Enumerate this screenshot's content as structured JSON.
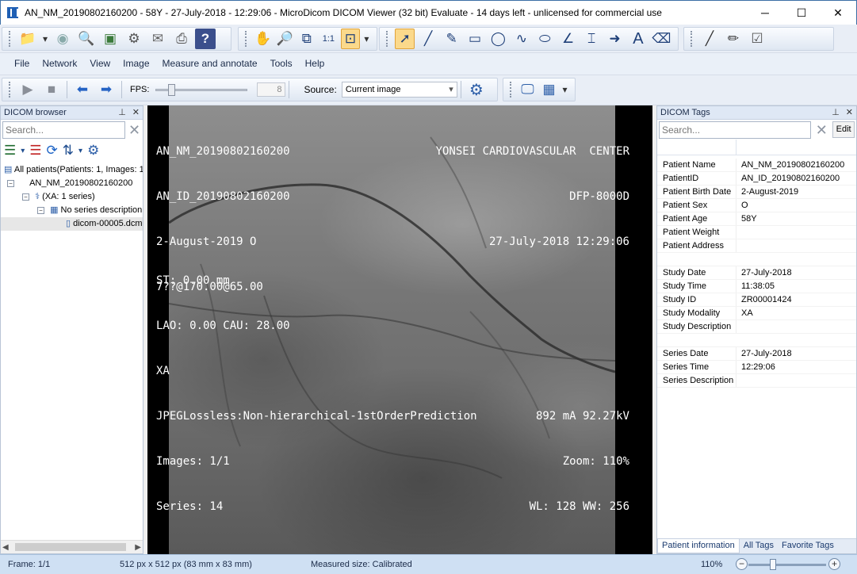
{
  "window": {
    "title": "AN_NM_20190802160200 - 58Y - 27-July-2018 - 12:29:06 - MicroDicom DICOM Viewer (32 bit) Evaluate - 14 days left - unlicensed for commercial use"
  },
  "menu": [
    "File",
    "Network",
    "View",
    "Image",
    "Measure and annotate",
    "Tools",
    "Help"
  ],
  "playback": {
    "fps_label": "FPS:",
    "fps_value": "8",
    "fps_slider_level": 0.15,
    "source_label": "Source:",
    "source_value": "Current image"
  },
  "browser": {
    "title": "DICOM browser",
    "search_placeholder": "Search...",
    "tree": {
      "root": "All patients(Patients: 1, Images: 1)",
      "patient": "AN_NM_20190802160200",
      "study": "(XA: 1 series)",
      "series": "No series description",
      "file": "dicom-00005.dcm"
    }
  },
  "viewer": {
    "top_left": [
      "AN_NM_20190802160200",
      "AN_ID_20190802160200",
      "2-August-2019 O",
      "7??@170.00@65.00"
    ],
    "top_right": [
      "YONSEI CARDIOVASCULAR  CENTER",
      "DFP-8000D",
      "27-July-2018 12:29:06"
    ],
    "bottom_left": [
      "ST: 0.00 mm",
      "LAO: 0.00 CAU: 28.00",
      "XA",
      "JPEGLossless:Non-hierarchical-1stOrderPrediction",
      "Images: 1/1",
      "Series: 14"
    ],
    "bottom_right": [
      "892 mA 92.27kV",
      "Zoom: 110%",
      "WL: 128 WW: 256"
    ]
  },
  "tags": {
    "title": "DICOM Tags",
    "search_placeholder": "Search...",
    "edit_label": "Edit",
    "groups": [
      [
        {
          "k": "Patient Name",
          "v": "AN_NM_20190802160200"
        },
        {
          "k": "PatientID",
          "v": "AN_ID_20190802160200"
        },
        {
          "k": "Patient Birth Date",
          "v": "2-August-2019"
        },
        {
          "k": "Patient Sex",
          "v": "O"
        },
        {
          "k": "Patient Age",
          "v": "58Y"
        },
        {
          "k": "Patient Weight",
          "v": ""
        },
        {
          "k": "Patient Address",
          "v": ""
        }
      ],
      [
        {
          "k": "Study Date",
          "v": "27-July-2018"
        },
        {
          "k": "Study Time",
          "v": "11:38:05"
        },
        {
          "k": "Study ID",
          "v": "ZR00001424"
        },
        {
          "k": "Study Modality",
          "v": "XA"
        },
        {
          "k": "Study Description",
          "v": ""
        }
      ],
      [
        {
          "k": "Series Date",
          "v": "27-July-2018"
        },
        {
          "k": "Series Time",
          "v": "12:29:06"
        },
        {
          "k": "Series Description",
          "v": ""
        }
      ]
    ],
    "tabs": [
      "Patient information",
      "All Tags",
      "Favorite Tags"
    ]
  },
  "status": {
    "frame": "Frame: 1/1",
    "size": "512 px x 512 px (83 mm x  83 mm)",
    "measured": "Measured size: Calibrated",
    "zoom": "110%",
    "zoom_level": 0.3
  },
  "colors": {
    "accent": "#1e5fb4",
    "toolbar_bg": "#e9eef6",
    "status_bg": "#cfe0f3",
    "active_tool": "#fbd98b"
  }
}
